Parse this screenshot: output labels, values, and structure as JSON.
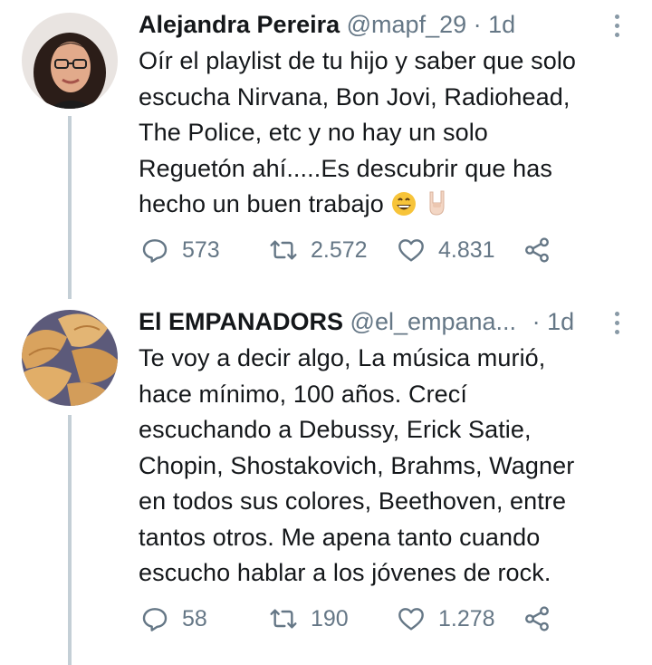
{
  "tweets": [
    {
      "name": "Alejandra Pereira",
      "handle": "@mapf_29",
      "separator": "·",
      "time": "1d",
      "body_lines": [
        "Oír el playlist de tu hijo y saber que solo",
        "escucha Nirvana, Bon Jovi, Radiohead,",
        "The Police, etc y no hay un solo",
        "Reguetón ahí.....Es descubrir que has",
        "hecho un buen trabajo"
      ],
      "emojis": [
        "grinning-face-emoji",
        "rock-on-hand-emoji"
      ],
      "replies": "573",
      "retweets": "2.572",
      "likes": "4.831"
    },
    {
      "name": "El EMPANADORS",
      "handle": "@el_empana...",
      "separator": "·",
      "time": "1d",
      "body_lines": [
        "Te voy a decir algo, La música murió,",
        "hace mínimo, 100 años. Crecí",
        "escuchando a Debussy, Erick Satie,",
        "Chopin, Shostakovich, Brahms, Wagner",
        "en todos sus colores, Beethoven, entre",
        "tantos otros. Me apena tanto cuando",
        "escucho hablar a los jóvenes de rock."
      ],
      "replies": "58",
      "retweets": "190",
      "likes": "1.278"
    }
  ],
  "colors": {
    "text": "#14171a",
    "muted": "#657786",
    "thread": "#c4cfd6",
    "icon": "#657786"
  },
  "icons": [
    "reply-icon",
    "retweet-icon",
    "like-icon",
    "share-icon",
    "more-icon"
  ]
}
